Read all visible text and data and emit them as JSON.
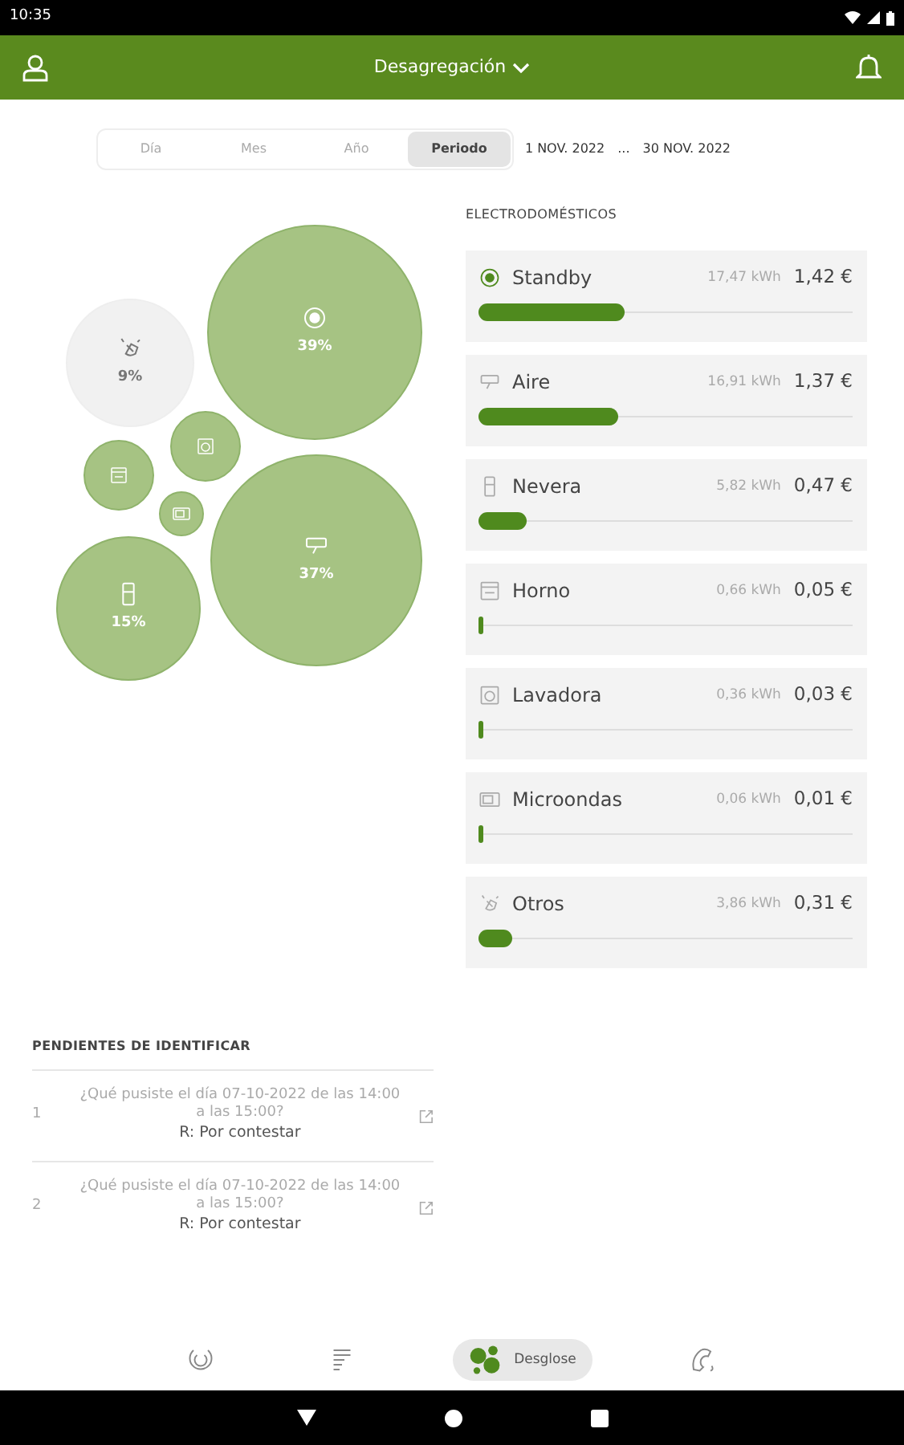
{
  "status_bar": {
    "time": "10:35"
  },
  "header": {
    "title": "Desagregación"
  },
  "period_tabs": [
    {
      "label": "Día",
      "selected": false
    },
    {
      "label": "Mes",
      "selected": false
    },
    {
      "label": "Año",
      "selected": false
    },
    {
      "label": "Periodo",
      "selected": true
    }
  ],
  "date_range": {
    "start": "1 NOV. 2022",
    "separator": "...",
    "end": "30 NOV. 2022"
  },
  "bubbles": [
    {
      "kind": "standby",
      "percent": "39%",
      "selected": false
    },
    {
      "kind": "otros",
      "percent": "9%",
      "selected": true
    },
    {
      "kind": "horno",
      "selected": false
    },
    {
      "kind": "lavadora",
      "selected": false
    },
    {
      "kind": "microondas",
      "selected": false
    },
    {
      "kind": "aire",
      "percent": "37%",
      "selected": false
    },
    {
      "kind": "nevera",
      "percent": "15%",
      "selected": false
    }
  ],
  "appliances": {
    "title": "ELECTRODOMÉSTICOS",
    "items": [
      {
        "kind": "standby",
        "name": "Standby",
        "energy": "17,47 kWh",
        "cost": "1,42 €",
        "level": 0.39
      },
      {
        "kind": "aire",
        "name": "Aire",
        "energy": "16,91 kWh",
        "cost": "1,37 €",
        "level": 0.375
      },
      {
        "kind": "nevera",
        "name": "Nevera",
        "energy": "5,82 kWh",
        "cost": "0,47 €",
        "level": 0.13
      },
      {
        "kind": "horno",
        "name": "Horno",
        "energy": "0,66 kWh",
        "cost": "0,05 €",
        "level": 0.01
      },
      {
        "kind": "lavadora",
        "name": "Lavadora",
        "energy": "0,36 kWh",
        "cost": "0,03 €",
        "level": 0.01
      },
      {
        "kind": "microondas",
        "name": "Microondas",
        "energy": "0,06 kWh",
        "cost": "0,01 €",
        "level": 0
      },
      {
        "kind": "otros",
        "name": "Otros",
        "energy": "3,86 kWh",
        "cost": "0,31 €",
        "level": 0.09
      }
    ]
  },
  "pending": {
    "title": "PENDIENTES DE IDENTIFICAR",
    "rows": [
      {
        "number": "1",
        "question": "¿Qué pusiste el día 07-10-2022 de las 14:00 a las 15:00?",
        "answer": "R: Por contestar"
      },
      {
        "number": "2",
        "question": "¿Qué pusiste el día 07-10-2022 de las 14:00 a las 15:00?",
        "answer": "R: Por contestar"
      }
    ]
  },
  "bottom_nav": [
    {
      "kind": "gauge",
      "selected": false
    },
    {
      "kind": "bars",
      "selected": false
    },
    {
      "kind": "bubbles",
      "label": "Desglose",
      "selected": true
    },
    {
      "kind": "phone",
      "selected": false
    }
  ]
}
